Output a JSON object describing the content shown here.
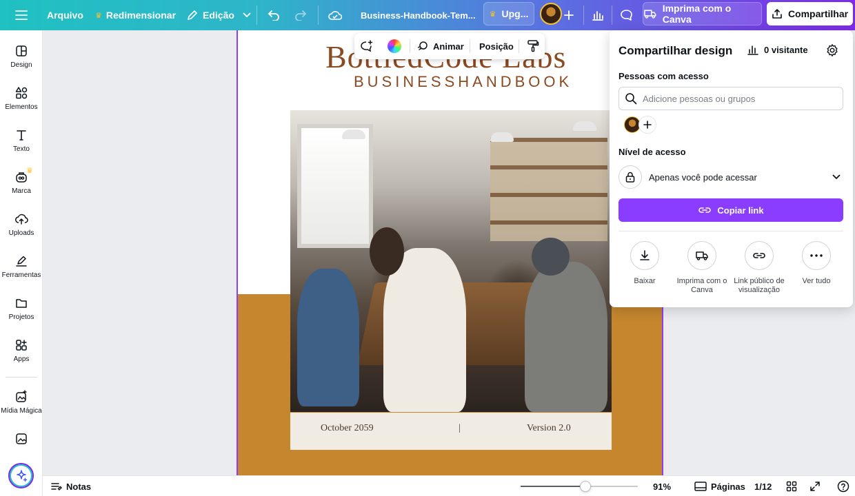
{
  "topbar": {
    "file": "Arquivo",
    "resize": "Redimensionar",
    "edit": "Edição",
    "doc_title": "Business-Handbook-Tem...",
    "upgrade": "Upg...",
    "print": "Imprima com o Canva",
    "share": "Compartilhar"
  },
  "sidebar": {
    "items": [
      {
        "label": "Design",
        "icon": "layout-icon"
      },
      {
        "label": "Elementos",
        "icon": "shapes-icon"
      },
      {
        "label": "Texto",
        "icon": "text-icon"
      },
      {
        "label": "Marca",
        "icon": "brand-icon"
      },
      {
        "label": "Uploads",
        "icon": "cloud-upload-icon"
      },
      {
        "label": "Ferramentas",
        "icon": "pen-icon"
      },
      {
        "label": "Projetos",
        "icon": "folder-icon"
      },
      {
        "label": "Apps",
        "icon": "apps-icon"
      },
      {
        "label": "Mídia Mágica",
        "icon": "magic-media-icon"
      }
    ]
  },
  "canvas": {
    "brand_name": "BottledCode Labs",
    "subtitle": "BUSINESSHANDBOOK",
    "footer_date": "October 2059",
    "footer_separator": "|",
    "footer_version": "Version 2.0",
    "accent_color": "#c5862e",
    "brand_color": "#8a4a23"
  },
  "context_toolbar": {
    "animate": "Animar",
    "position": "Posição"
  },
  "share_panel": {
    "title": "Compartilhar design",
    "visitors": "0 visitante",
    "people_label": "Pessoas com acesso",
    "search_placeholder": "Adicione pessoas ou grupos",
    "access_level_label": "Nível de acesso",
    "access_value": "Apenas você pode acessar",
    "copy_link": "Copiar link",
    "actions": [
      {
        "label": "Baixar",
        "icon": "download-icon"
      },
      {
        "label": "Imprima com o Canva",
        "icon": "truck-icon"
      },
      {
        "label": "Link público de visualização",
        "icon": "link-icon"
      },
      {
        "label": "Ver tudo",
        "icon": "more-icon"
      }
    ],
    "primary_color": "#8b3dff"
  },
  "bottombar": {
    "notes": "Notas",
    "zoom": "91%",
    "zoom_level": 0.55,
    "pages": "Páginas",
    "page_count": "1/12"
  }
}
